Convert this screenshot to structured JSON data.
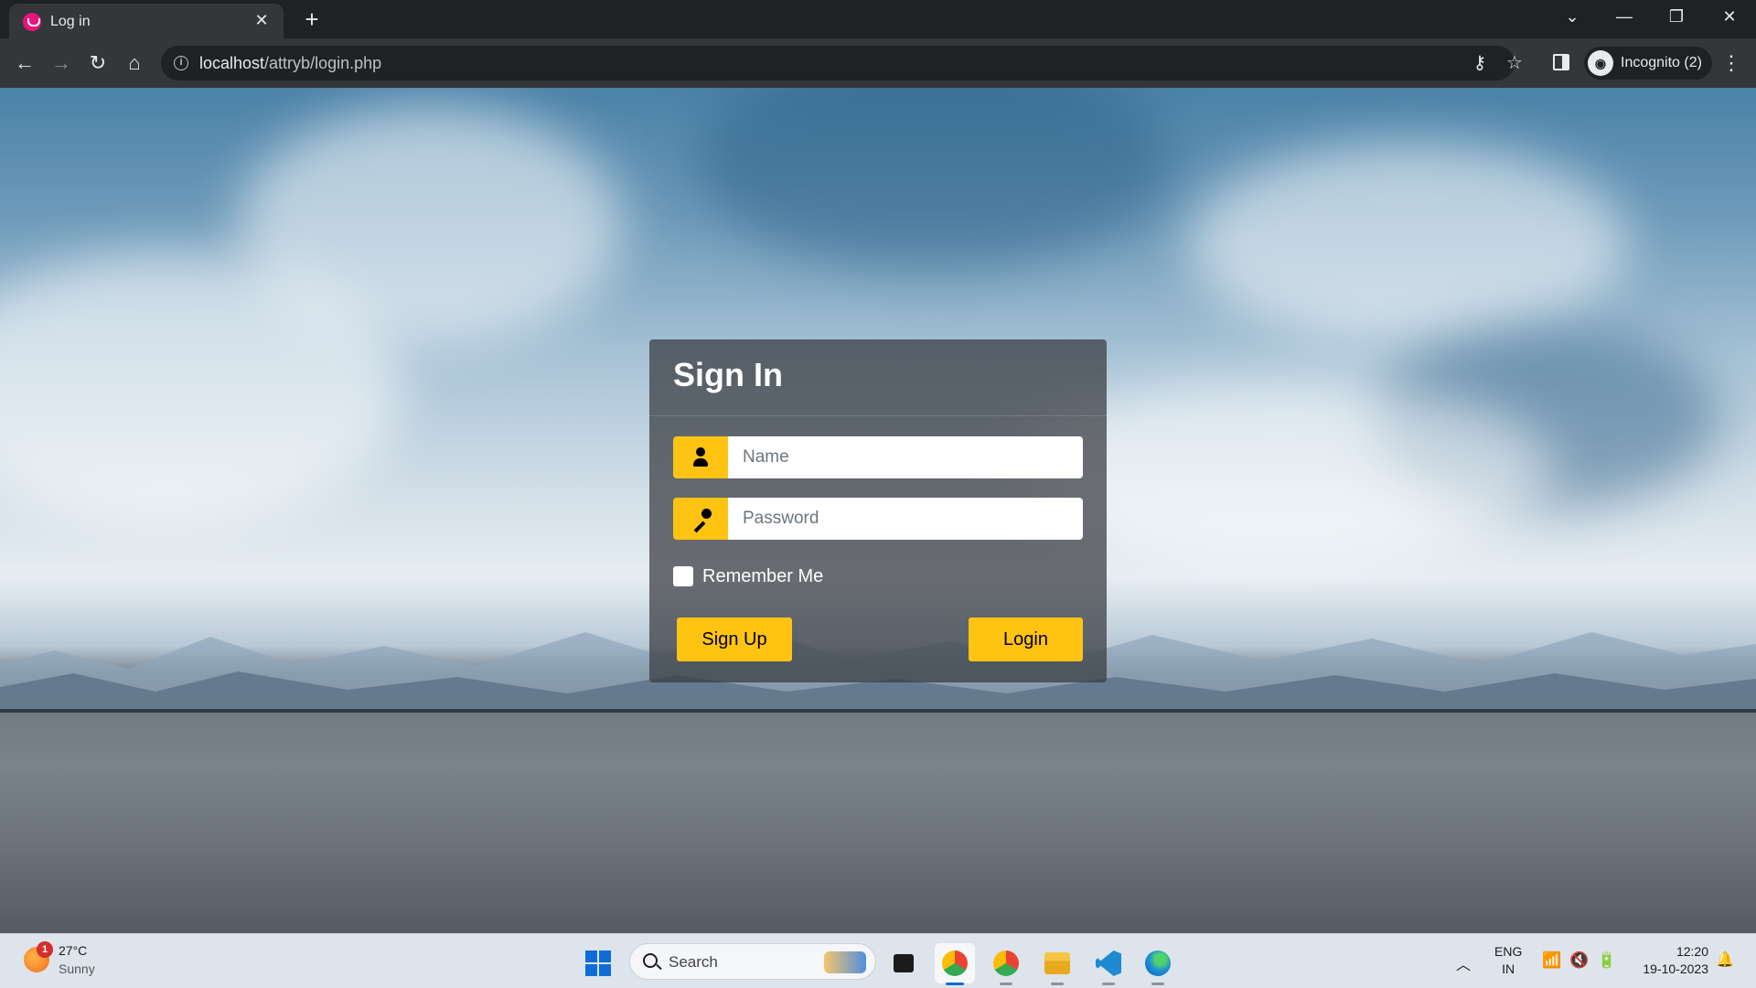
{
  "browser": {
    "tab_title": "Log in",
    "tab_close": "✕",
    "new_tab": "+",
    "url_host": "localhost",
    "url_path": "/attryb/login.php",
    "incognito_label": "Incognito (2)",
    "icons": [
      "back-icon",
      "forward-icon",
      "reload-icon",
      "home-icon",
      "info-icon",
      "key-icon",
      "star-icon",
      "side-panel-icon",
      "incognito-icon",
      "menu-icon"
    ]
  },
  "login": {
    "title": "Sign In",
    "name_placeholder": "Name",
    "password_placeholder": "Password",
    "remember_label": "Remember Me",
    "signup_label": "Sign Up",
    "login_label": "Login",
    "accent_color": "#ffc312"
  },
  "taskbar": {
    "weather_badge": "1",
    "weather_temp": "27°C",
    "weather_desc": "Sunny",
    "search_label": "Search",
    "lang_line1": "ENG",
    "lang_line2": "IN",
    "time": "12:20",
    "date": "19-10-2023",
    "apps": [
      "windows-start",
      "search",
      "task-view",
      "chrome",
      "chrome-profile",
      "file-explorer",
      "vs-code",
      "edge"
    ]
  }
}
